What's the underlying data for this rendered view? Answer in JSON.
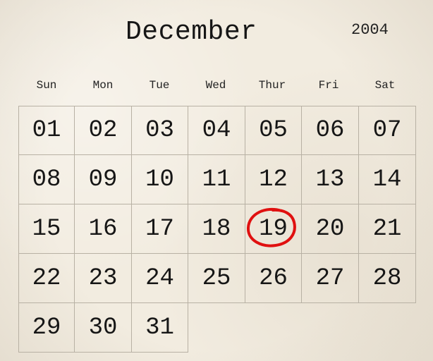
{
  "calendar": {
    "month": "December",
    "year": "2004",
    "weekdays": [
      "Sun",
      "Mon",
      "Tue",
      "Wed",
      "Thur",
      "Fri",
      "Sat"
    ],
    "days": [
      "01",
      "02",
      "03",
      "04",
      "05",
      "06",
      "07",
      "08",
      "09",
      "10",
      "11",
      "12",
      "13",
      "14",
      "15",
      "16",
      "17",
      "18",
      "19",
      "20",
      "21",
      "22",
      "23",
      "24",
      "25",
      "26",
      "27",
      "28",
      "29",
      "30",
      "31"
    ],
    "highlighted_day": "19",
    "highlight_color": "#e01010"
  }
}
